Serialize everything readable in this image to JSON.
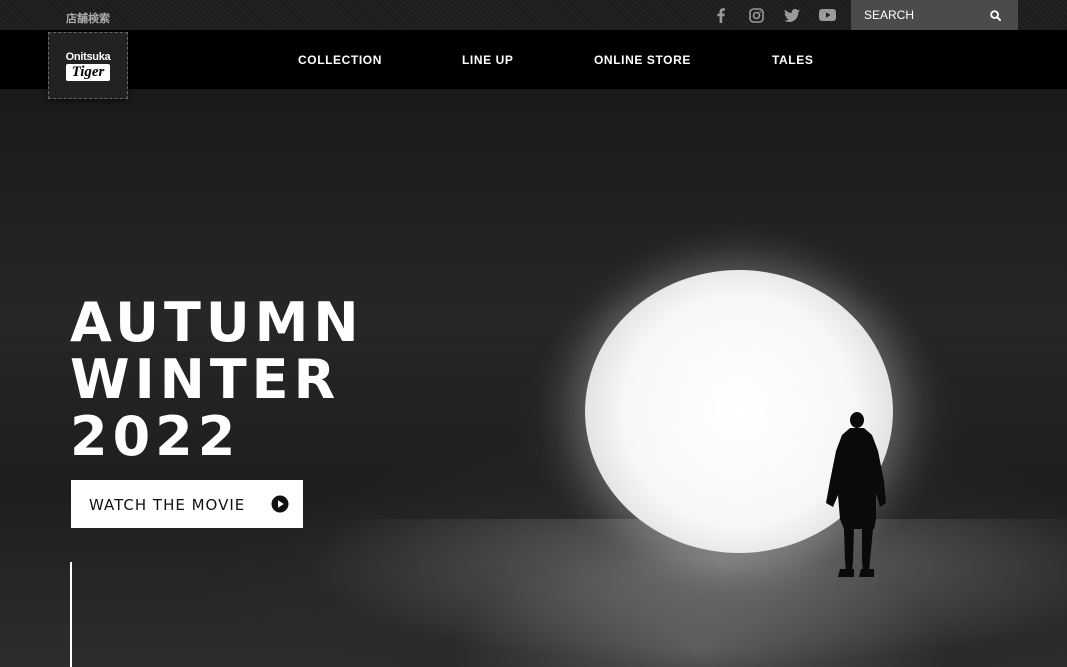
{
  "topbar": {
    "store_search": "店舗検索",
    "social": [
      "facebook-icon",
      "instagram-icon",
      "twitter-icon",
      "youtube-icon"
    ],
    "search": {
      "placeholder": "SEARCH"
    }
  },
  "logo": {
    "top": "Onitsuka",
    "bottom": "Tiger"
  },
  "nav": {
    "items": [
      {
        "label": "COLLECTION"
      },
      {
        "label": "LINE UP"
      },
      {
        "label": "ONLINE STORE"
      },
      {
        "label": "TALES"
      }
    ]
  },
  "hero": {
    "headline": [
      "AUTUMN",
      "WINTER",
      "2022"
    ],
    "cta_label": "WATCH THE MOVIE"
  },
  "colors": {
    "background": "#000000",
    "topbar": "#1c1c1c",
    "search_box": "#4b4b4b",
    "text": "#ffffff"
  }
}
